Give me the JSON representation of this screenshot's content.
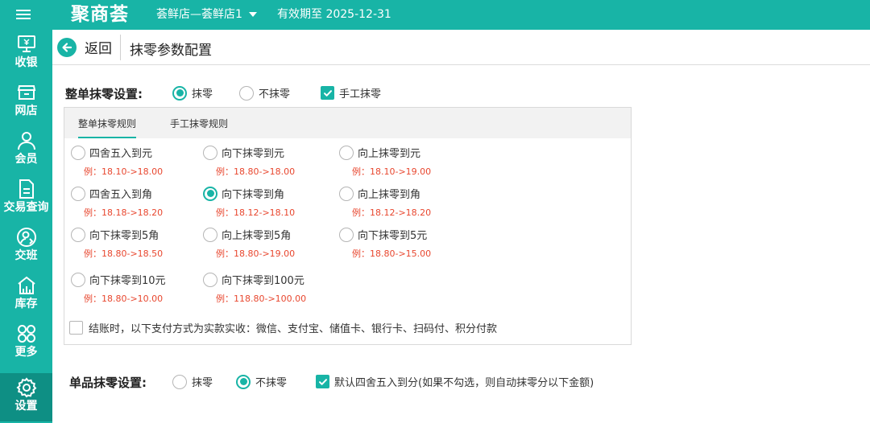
{
  "topbar": {
    "logo": "聚商荟",
    "store": "荟鲜店—荟鲜店1",
    "expiry": "有效期至 2025-12-31"
  },
  "sidebar": {
    "items": [
      {
        "label": "收银",
        "icon": "cashier-icon"
      },
      {
        "label": "网店",
        "icon": "store-icon"
      },
      {
        "label": "会员",
        "icon": "member-icon"
      },
      {
        "label": "交易查询",
        "icon": "transaction-icon"
      },
      {
        "label": "交班",
        "icon": "shift-icon"
      },
      {
        "label": "库存",
        "icon": "inventory-icon"
      },
      {
        "label": "更多",
        "icon": "more-icon"
      },
      {
        "label": "设置",
        "icon": "settings-icon",
        "active": true
      }
    ]
  },
  "header": {
    "back_label": "返回",
    "title": "抹零参数配置"
  },
  "order_rounding": {
    "label": "整单抹零设置:",
    "options": [
      {
        "label": "抹零",
        "selected": true
      },
      {
        "label": "不抹零",
        "selected": false
      }
    ],
    "manual": {
      "label": "手工抹零",
      "checked": true
    },
    "tabs": [
      "整单抹零规则",
      "手工抹零规则"
    ],
    "rules": [
      {
        "label": "四舍五入到元",
        "example": "例：18.10->18.00",
        "selected": false
      },
      {
        "label": "向下抹零到元",
        "example": "例：18.80->18.00",
        "selected": false
      },
      {
        "label": "向上抹零到元",
        "example": "例：18.10->19.00",
        "selected": false
      },
      {
        "label": "四舍五入到角",
        "example": "例：18.18->18.20",
        "selected": false
      },
      {
        "label": "向下抹零到角",
        "example": "例：18.12->18.10",
        "selected": true
      },
      {
        "label": "向上抹零到角",
        "example": "例：18.12->18.20",
        "selected": false
      },
      {
        "label": "向下抹零到5角",
        "example": "例：18.80->18.50",
        "selected": false
      },
      {
        "label": "向上抹零到5角",
        "example": "例：18.80->19.00",
        "selected": false
      },
      {
        "label": "向下抹零到5元",
        "example": "例：18.80->15.00",
        "selected": false
      },
      {
        "label": "向下抹零到10元",
        "example": "例：18.80->10.00",
        "selected": false
      },
      {
        "label": "向下抹零到100元",
        "example": "例：118.80->100.00",
        "selected": false
      }
    ],
    "payment_note": "结账时，以下支付方式为实款实收：微信、支付宝、储值卡、银行卡、扫码付、积分付款"
  },
  "item_rounding": {
    "label": "单品抹零设置:",
    "options": [
      {
        "label": "抹零",
        "selected": false
      },
      {
        "label": "不抹零",
        "selected": true
      }
    ],
    "default_check": {
      "label": "默认四舍五入到分(如果不勾选，则自动抹零分以下金额)",
      "checked": true
    }
  },
  "colors": {
    "accent": "#18b4a6",
    "example_text": "#e8472f"
  }
}
